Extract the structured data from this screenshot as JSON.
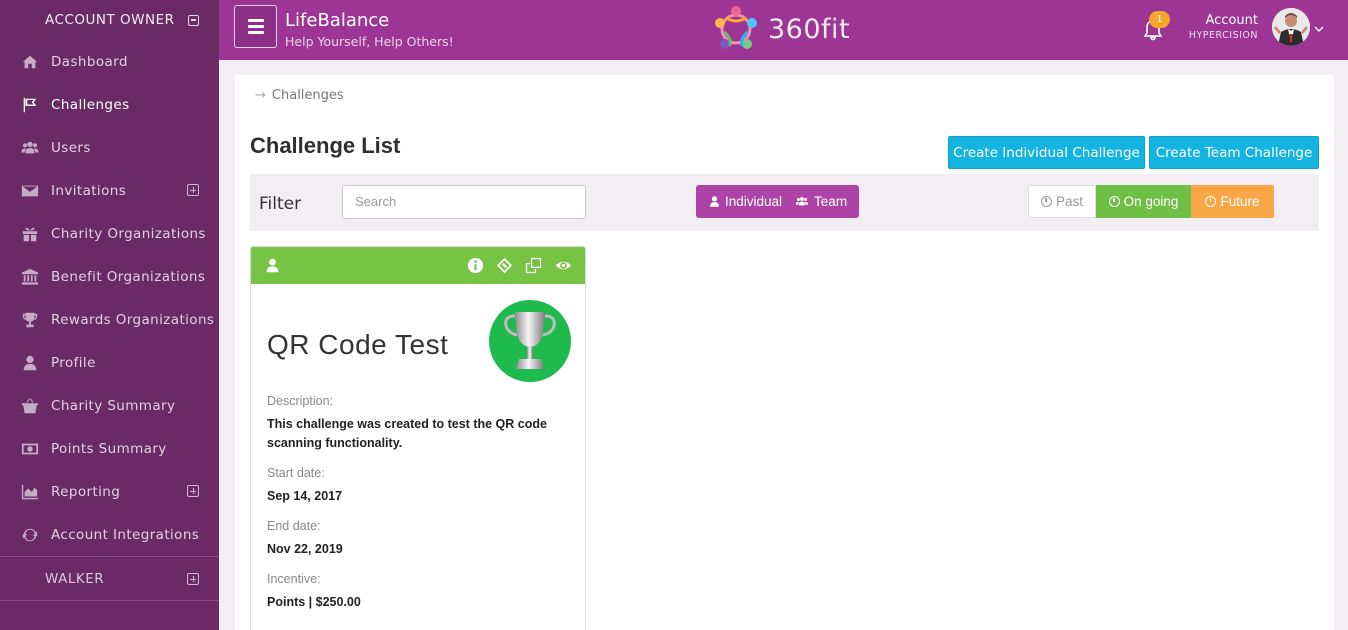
{
  "sidebar": {
    "header": "ACCOUNT OWNER",
    "items": [
      {
        "label": "Dashboard",
        "icon": "home-icon"
      },
      {
        "label": "Challenges",
        "icon": "flag-icon"
      },
      {
        "label": "Users",
        "icon": "users-icon"
      },
      {
        "label": "Invitations",
        "icon": "envelope-icon"
      },
      {
        "label": "Charity Organizations",
        "icon": "gift-icon"
      },
      {
        "label": "Benefit Organizations",
        "icon": "bank-icon"
      },
      {
        "label": "Rewards Organizations",
        "icon": "trophy-icon"
      },
      {
        "label": "Profile",
        "icon": "user-icon"
      },
      {
        "label": "Charity Summary",
        "icon": "basket-icon"
      },
      {
        "label": "Points Summary",
        "icon": "money-icon"
      },
      {
        "label": "Reporting",
        "icon": "area-chart-icon"
      },
      {
        "label": "Account Integrations",
        "icon": "refresh-icon"
      }
    ],
    "section2": "WALKER"
  },
  "header": {
    "app_name": "LifeBalance",
    "tagline": "Help Yourself, Help Others!",
    "logo_text": "360fit",
    "notification_count": "1",
    "account_label": "Account",
    "account_org": "HYPERCISION"
  },
  "breadcrumb": "Challenges",
  "page_title": "Challenge List",
  "buttons": {
    "create_individual": "Create Individual Challenge",
    "create_team": "Create Team Challenge"
  },
  "filter": {
    "label": "Filter",
    "search_placeholder": "Search",
    "type_individual": "Individual",
    "type_team": "Team",
    "past": "Past",
    "ongoing": "On going",
    "future": "Future"
  },
  "card": {
    "title": "QR Code Test",
    "description_label": "Description:",
    "description": "This challenge was created to test the QR code scanning functionality.",
    "start_label": "Start date:",
    "start": "Sep 14, 2017",
    "end_label": "End date:",
    "end": "Nov 22, 2019",
    "incentive_label": "Incentive:",
    "incentive": "Points | $250.00"
  },
  "colors": {
    "sidebar": "#6a2a66",
    "header": "#9c3594",
    "accent_blue": "#14b4e0",
    "green": "#77c344",
    "ongoing_green": "#6fbf47",
    "future_orange": "#f9a746"
  }
}
